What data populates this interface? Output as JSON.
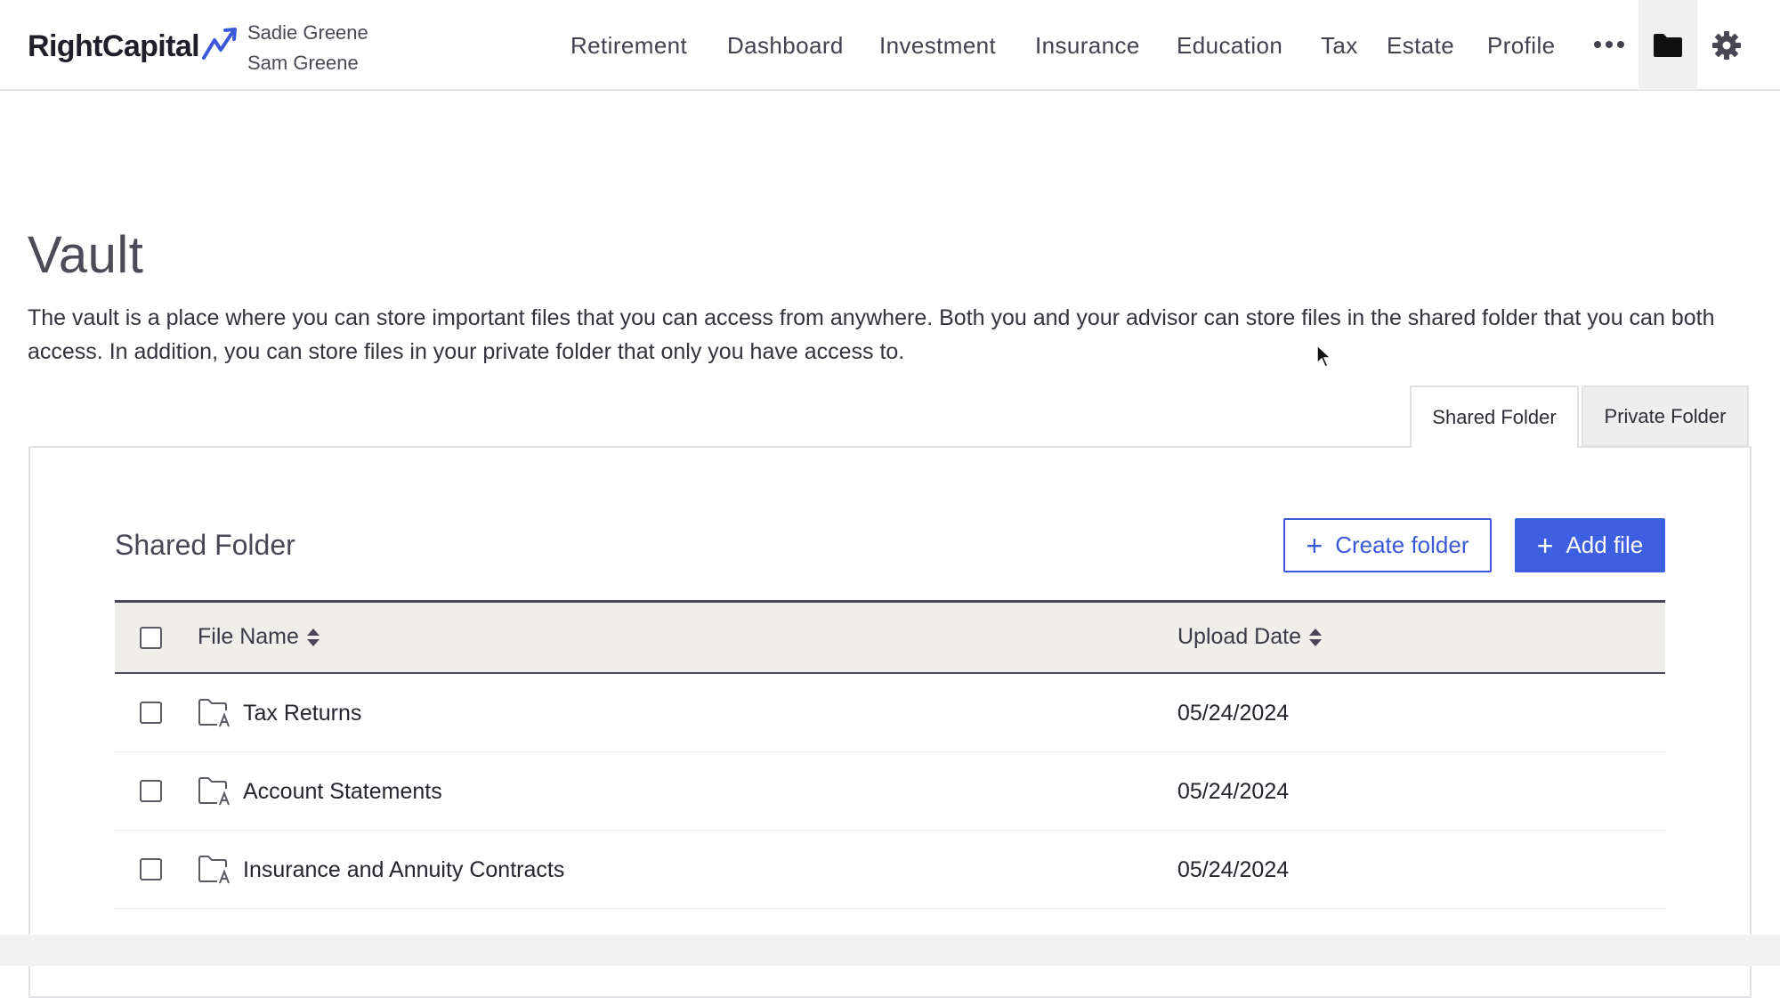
{
  "header": {
    "logo_text": "RightCapital",
    "clients": [
      "Sadie Greene",
      "Sam Greene"
    ],
    "nav": [
      "Retirement",
      "Dashboard",
      "Investment",
      "Insurance",
      "Education",
      "Tax",
      "Estate",
      "Profile"
    ],
    "icons": [
      "more-icon",
      "folder-icon",
      "gear-icon"
    ]
  },
  "page": {
    "title": "Vault",
    "description": "The vault is a place where you can store important files that you can access from anywhere. Both you and your advisor can store files in the shared folder that you can both access. In addition, you can store files in your private folder that only you have access to."
  },
  "tabs": [
    {
      "label": "Shared Folder",
      "active": true
    },
    {
      "label": "Private Folder",
      "active": false
    }
  ],
  "panel": {
    "title": "Shared Folder",
    "create_folder_label": "Create folder",
    "add_file_label": "Add file"
  },
  "table": {
    "columns": [
      "File Name",
      "Upload Date"
    ],
    "rows": [
      {
        "name": "Tax Returns",
        "date": "05/24/2024"
      },
      {
        "name": "Account Statements",
        "date": "05/24/2024"
      },
      {
        "name": "Insurance and Annuity Contracts",
        "date": "05/24/2024"
      }
    ]
  },
  "colors": {
    "accent": "#3e5fe0",
    "logo_mark": "#3b58d9",
    "header_bg": "#efeeeb"
  }
}
